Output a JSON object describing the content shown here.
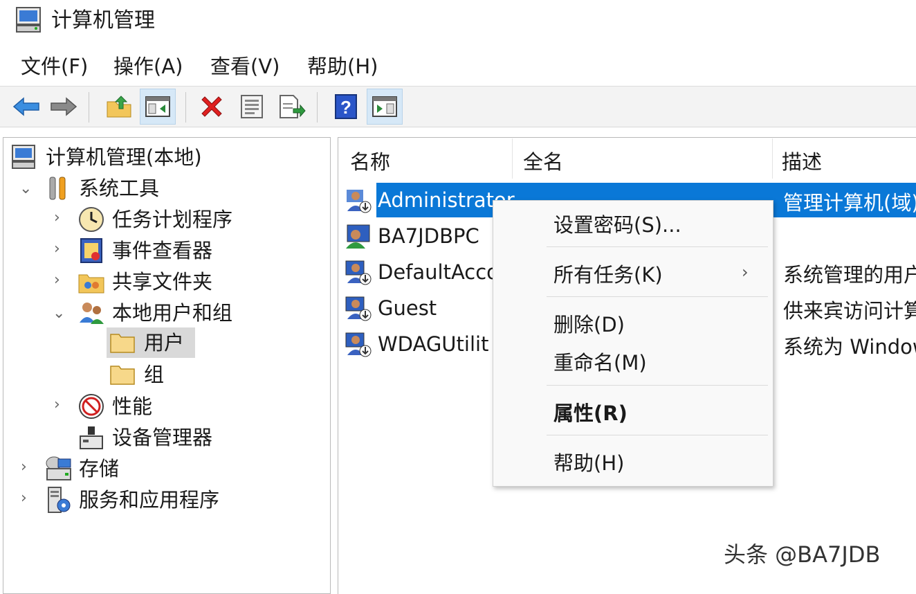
{
  "window": {
    "title": "计算机管理"
  },
  "menu": [
    "文件(F)",
    "操作(A)",
    "查看(V)",
    "帮助(H)"
  ],
  "toolbar": {
    "buttons": [
      "back-icon",
      "forward-icon",
      "up-folder-icon",
      "show-hide-tree-icon",
      "delete-icon",
      "properties-icon",
      "export-list-icon",
      "help-icon",
      "show-hide-action-pane-icon"
    ]
  },
  "tree": {
    "root": "计算机管理(本地)",
    "system_tools": "系统工具",
    "task_scheduler": "任务计划程序",
    "event_viewer": "事件查看器",
    "shared_folders": "共享文件夹",
    "local_users_groups": "本地用户和组",
    "users": "用户",
    "groups": "组",
    "performance": "性能",
    "device_manager": "设备管理器",
    "storage": "存储",
    "services_apps": "服务和应用程序"
  },
  "list": {
    "headers": {
      "name": "名称",
      "fullname": "全名",
      "description": "描述"
    },
    "rows": [
      {
        "name": "Administrator",
        "description": "管理计算机(域)"
      },
      {
        "name": "BA7JDBPC",
        "description": ""
      },
      {
        "name": "DefaultAcco",
        "description": "系统管理的用户"
      },
      {
        "name": "Guest",
        "description": "供来宾访问计算"
      },
      {
        "name": "WDAGUtilit",
        "description": "系统为 Window"
      }
    ]
  },
  "context_menu": {
    "set_password": "设置密码(S)...",
    "all_tasks": "所有任务(K)",
    "submenu_arrow": "›",
    "delete": "删除(D)",
    "rename": "重命名(M)",
    "properties": "属性(R)",
    "help": "帮助(H)"
  },
  "watermark": "头条 @BA7JDB",
  "colors": {
    "selection": "#0a78d7",
    "accent": "#1e64c8"
  }
}
